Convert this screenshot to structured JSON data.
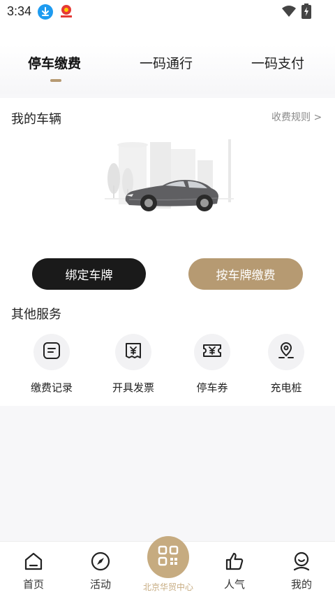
{
  "status_bar": {
    "time": "3:34"
  },
  "tabs": [
    {
      "label": "停车缴费",
      "active": true
    },
    {
      "label": "一码通行",
      "active": false
    },
    {
      "label": "一码支付",
      "active": false
    }
  ],
  "vehicles": {
    "title": "我的车辆",
    "fee_rules_link": "收费规则 >"
  },
  "buttons": {
    "bind_plate": "绑定车牌",
    "pay_by_plate": "按车牌缴费"
  },
  "services": {
    "title": "其他服务",
    "items": [
      {
        "label": "缴费记录",
        "icon": "receipt-list-icon"
      },
      {
        "label": "开具发票",
        "icon": "invoice-icon"
      },
      {
        "label": "停车券",
        "icon": "parking-coupon-icon"
      },
      {
        "label": "充电桩",
        "icon": "charging-pile-icon"
      }
    ]
  },
  "bottom_nav": {
    "items": [
      {
        "label": "首页",
        "icon": "home-icon"
      },
      {
        "label": "活动",
        "icon": "compass-icon"
      },
      {
        "label": "人气",
        "icon": "thumbs-up-icon"
      },
      {
        "label": "我的",
        "icon": "profile-icon"
      }
    ],
    "center": {
      "label": "北京华贸中心",
      "icon": "qr-code-icon"
    }
  },
  "colors": {
    "accent": "#b69a72",
    "center_button": "#c6ab80",
    "dark_button": "#1a1a1a"
  }
}
